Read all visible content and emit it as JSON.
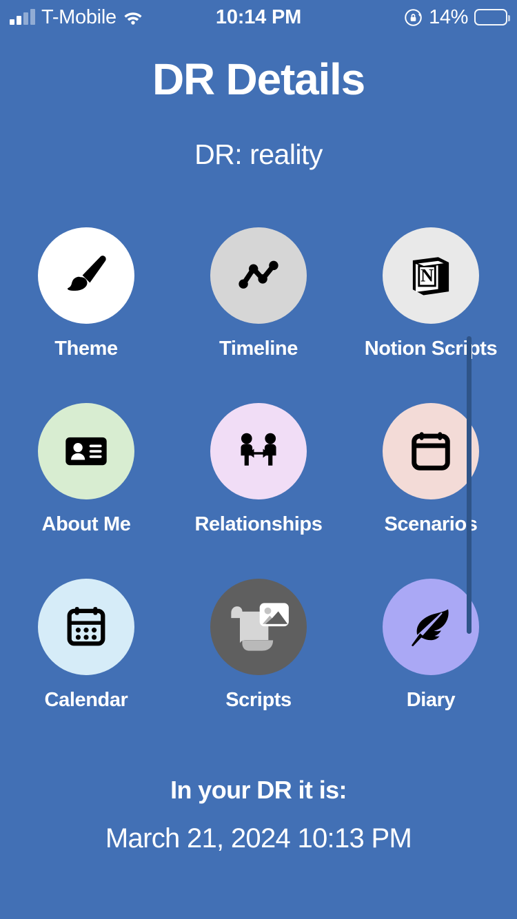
{
  "status_bar": {
    "carrier": "T-Mobile",
    "signal_icon": "cellular-signal-icon",
    "wifi_icon": "wifi-icon",
    "time": "10:14 PM",
    "rotation_lock_icon": "rotation-lock-icon",
    "battery_percent_label": "14%",
    "battery_level": 14,
    "battery_fill_color": "#ef3b2d"
  },
  "header": {
    "title": "DR Details",
    "subtitle": "DR: reality"
  },
  "theme": {
    "background": "#4270b5",
    "text_color": "#ffffff",
    "scrollbar_color": "#2f5488"
  },
  "grid": {
    "tiles": [
      {
        "label": "Theme",
        "icon": "paintbrush-icon",
        "circle_color": "#ffffff",
        "icon_color": "#000000"
      },
      {
        "label": "Timeline",
        "icon": "line-chart-icon",
        "circle_color": "#d6d6d6",
        "icon_color": "#000000"
      },
      {
        "label": "Notion Scripts",
        "icon": "notion-logo-icon",
        "circle_color": "#e9e9e9",
        "icon_color": "#000000"
      },
      {
        "label": "About Me",
        "icon": "id-card-icon",
        "circle_color": "#d8edd1",
        "icon_color": "#000000"
      },
      {
        "label": "Relationships",
        "icon": "two-people-arrow-icon",
        "circle_color": "#f1ddf6",
        "icon_color": "#000000"
      },
      {
        "label": "Scenarios",
        "icon": "calendar-blank-icon",
        "circle_color": "#f3dbd7",
        "icon_color": "#000000"
      },
      {
        "label": "Calendar",
        "icon": "calendar-dots-icon",
        "circle_color": "#d6ecf8",
        "icon_color": "#000000"
      },
      {
        "label": "Scripts",
        "icon": "scroll-image-icon",
        "circle_color": "#5f5f5f",
        "icon_color": "#d0d0d0"
      },
      {
        "label": "Diary",
        "icon": "feather-quill-icon",
        "circle_color": "#aaa8f5",
        "icon_color": "#000000"
      }
    ]
  },
  "footer": {
    "heading": "In your DR it is:",
    "datetime": "March 21, 2024 10:13 PM"
  }
}
